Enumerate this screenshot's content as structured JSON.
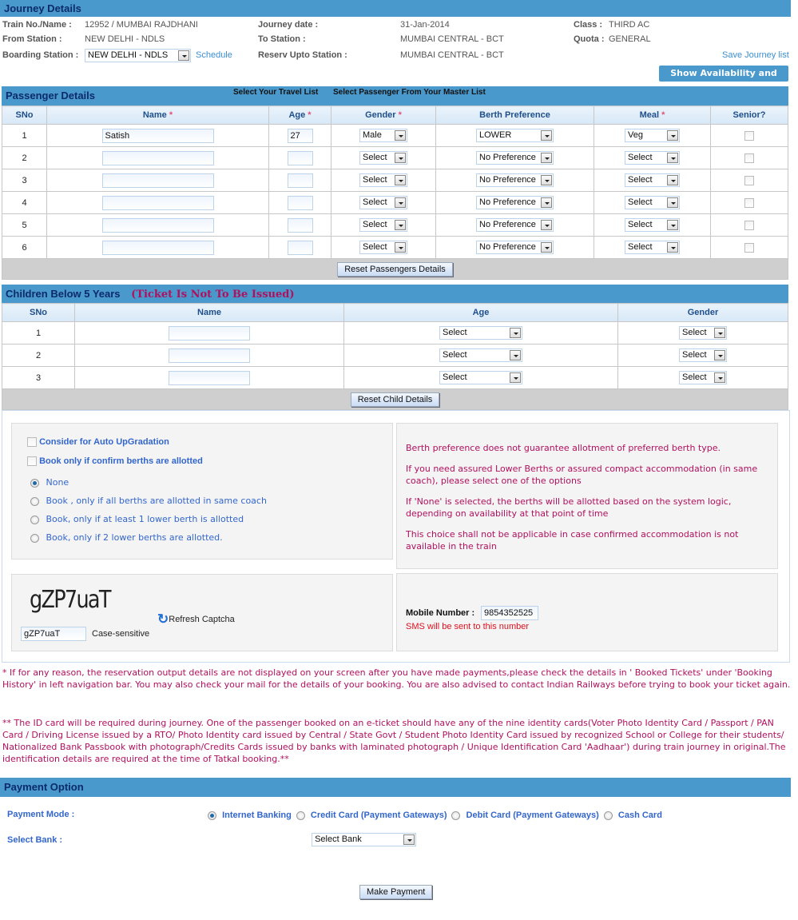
{
  "journey": {
    "title": "Journey Details",
    "train_label": "Train No./Name :",
    "train_value": "12952 / MUMBAI RAJDHANI",
    "from_label": "From Station :",
    "from_value": "NEW DELHI - NDLS",
    "boarding_label": "Boarding Station :",
    "boarding_value": "NEW DELHI - NDLS",
    "schedule_link": "Schedule",
    "date_label": "Journey date :",
    "date_value": "31-Jan-2014",
    "to_label": "To Station :",
    "to_value": "MUMBAI CENTRAL - BCT",
    "upto_label": "Reserv Upto Station :",
    "upto_value": "MUMBAI CENTRAL - BCT",
    "class_label": "Class :",
    "class_value": "THIRD AC",
    "quota_label": "Quota :",
    "quota_value": "GENERAL",
    "save_link": "Save Journey list",
    "availability_button": "Show Availability and Fare"
  },
  "passengers": {
    "title": "Passenger Details",
    "travel_list_link": "Select Your Travel List",
    "master_list_link": "Select Passenger From Your Master List",
    "columns": [
      "SNo",
      "Name",
      "Age",
      "Gender",
      "Berth Preference",
      "Meal",
      "Senior?"
    ],
    "required_mark": "*",
    "rows": [
      {
        "sno": "1",
        "name": "Satish",
        "age": "27",
        "gender": "Male",
        "berth": "LOWER",
        "meal": "Veg",
        "senior": false
      },
      {
        "sno": "2",
        "name": "",
        "age": "",
        "gender": "Select",
        "berth": "No Preference",
        "meal": "Select",
        "senior": false
      },
      {
        "sno": "3",
        "name": "",
        "age": "",
        "gender": "Select",
        "berth": "No Preference",
        "meal": "Select",
        "senior": false
      },
      {
        "sno": "4",
        "name": "",
        "age": "",
        "gender": "Select",
        "berth": "No Preference",
        "meal": "Select",
        "senior": false
      },
      {
        "sno": "5",
        "name": "",
        "age": "",
        "gender": "Select",
        "berth": "No Preference",
        "meal": "Select",
        "senior": false
      },
      {
        "sno": "6",
        "name": "",
        "age": "",
        "gender": "Select",
        "berth": "No Preference",
        "meal": "Select",
        "senior": false
      }
    ],
    "reset_button": "Reset Passengers Details"
  },
  "children": {
    "title": "Children Below 5 Years",
    "note": "(Ticket Is Not To Be Issued)",
    "columns": [
      "SNo",
      "Name",
      "Age",
      "Gender"
    ],
    "rows": [
      {
        "sno": "1",
        "name": "",
        "age": "Select",
        "gender": "Select"
      },
      {
        "sno": "2",
        "name": "",
        "age": "Select",
        "gender": "Select"
      },
      {
        "sno": "3",
        "name": "",
        "age": "Select",
        "gender": "Select"
      }
    ],
    "reset_button": "Reset Child Details"
  },
  "options": {
    "auto_upgrade": "Consider for Auto UpGradation",
    "confirm_only": "Book only if confirm berths are allotted",
    "radios": [
      {
        "label": "None",
        "selected": true
      },
      {
        "label": "Book , only if all berths are allotted in same coach",
        "selected": false
      },
      {
        "label": "Book, only if at least 1 lower berth is allotted",
        "selected": false
      },
      {
        "label": "Book, only if 2 lower berths are allotted.",
        "selected": false
      }
    ],
    "info": [
      "Berth preference does not guarantee allotment of preferred berth type.",
      "If you need assured Lower Berths or assured compact accommodation (in same coach), please select one of the options",
      "If 'None' is selected, the berths will be allotted based on the system logic, depending on availability at that point of time",
      "This choice shall not be applicable in case confirmed accommodation is not available in the train"
    ]
  },
  "captcha": {
    "image_text": "gZP7uaT",
    "input_value": "gZP7uaT",
    "case_note": "Case-sensitive",
    "refresh_label": "Refresh Captcha"
  },
  "mobile": {
    "label": "Mobile Number :",
    "value": "9854352525",
    "note": "SMS will be sent to this number"
  },
  "notes": {
    "note1": "* If for any reason, the reservation output details are not displayed on your screen after you have made payments,please check the details in ' Booked Tickets' under 'Booking History' in left navigation bar. You may also check your mail for the details of your booking. You are also advised to contact Indian Railways before trying to book your ticket again.",
    "note2": "** The ID card will be required during journey. One of the passenger booked on an e-ticket should have any of the nine identity cards(Voter Photo Identity Card / Passport / PAN Card / Driving License issued by a RTO/ Photo Identity card issued by Central / State Govt / Student Photo Identity Card issued by recognized School or College for their students/ Nationalized Bank Passbook with photograph/Credits Cards issued by banks with laminated photograph / Unique Identification Card 'Aadhaar') during train journey in original.The identification details are required at the time of Tatkal booking.**"
  },
  "payment": {
    "title": "Payment Option",
    "mode_label": "Payment Mode :",
    "modes": [
      {
        "label": "Internet Banking",
        "selected": true
      },
      {
        "label": "Credit Card (Payment Gateways)",
        "selected": false
      },
      {
        "label": "Debit Card (Payment Gateways)",
        "selected": false
      },
      {
        "label": "Cash Card",
        "selected": false
      }
    ],
    "bank_label": "Select Bank :",
    "bank_value": "Select Bank",
    "pay_button": "Make Payment"
  }
}
